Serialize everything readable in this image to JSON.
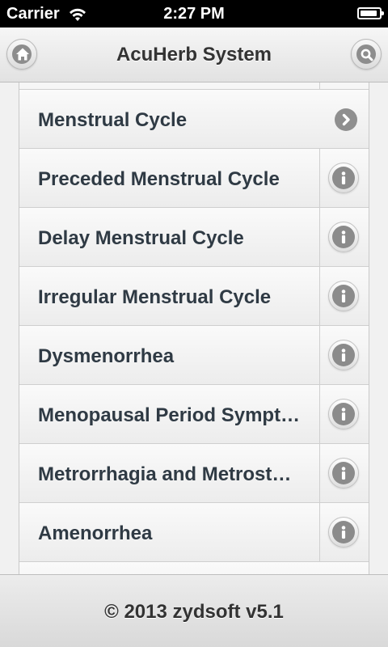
{
  "status_bar": {
    "carrier": "Carrier",
    "time": "2:27 PM",
    "battery_level": 0.9
  },
  "header": {
    "title": "AcuHerb System",
    "home_icon": "home-icon",
    "search_icon": "search-icon"
  },
  "list": {
    "items": [
      {
        "label": "Menstrual Cycle",
        "action_icon": "chevron-right-icon"
      },
      {
        "label": "Preceded Menstrual Cycle",
        "action_icon": "info-icon"
      },
      {
        "label": "Delay Menstrual Cycle",
        "action_icon": "info-icon"
      },
      {
        "label": "Irregular Menstrual Cycle",
        "action_icon": "info-icon"
      },
      {
        "label": "Dysmenorrhea",
        "action_icon": "info-icon"
      },
      {
        "label": "Menopausal Period Sympt…",
        "action_icon": "info-icon"
      },
      {
        "label": "Metrorrhagia and Metrosta…",
        "action_icon": "info-icon"
      },
      {
        "label": "Amenorrhea",
        "action_icon": "info-icon"
      }
    ]
  },
  "footer": {
    "text": "© 2013 zydsoft v5.1"
  },
  "colors": {
    "status_bar_bg": "#000000",
    "header_bg": "#e9e9e9",
    "item_text": "#2f3a44",
    "icon_gray": "#8b8b8b",
    "footer_bg": "#e2e2e2"
  }
}
